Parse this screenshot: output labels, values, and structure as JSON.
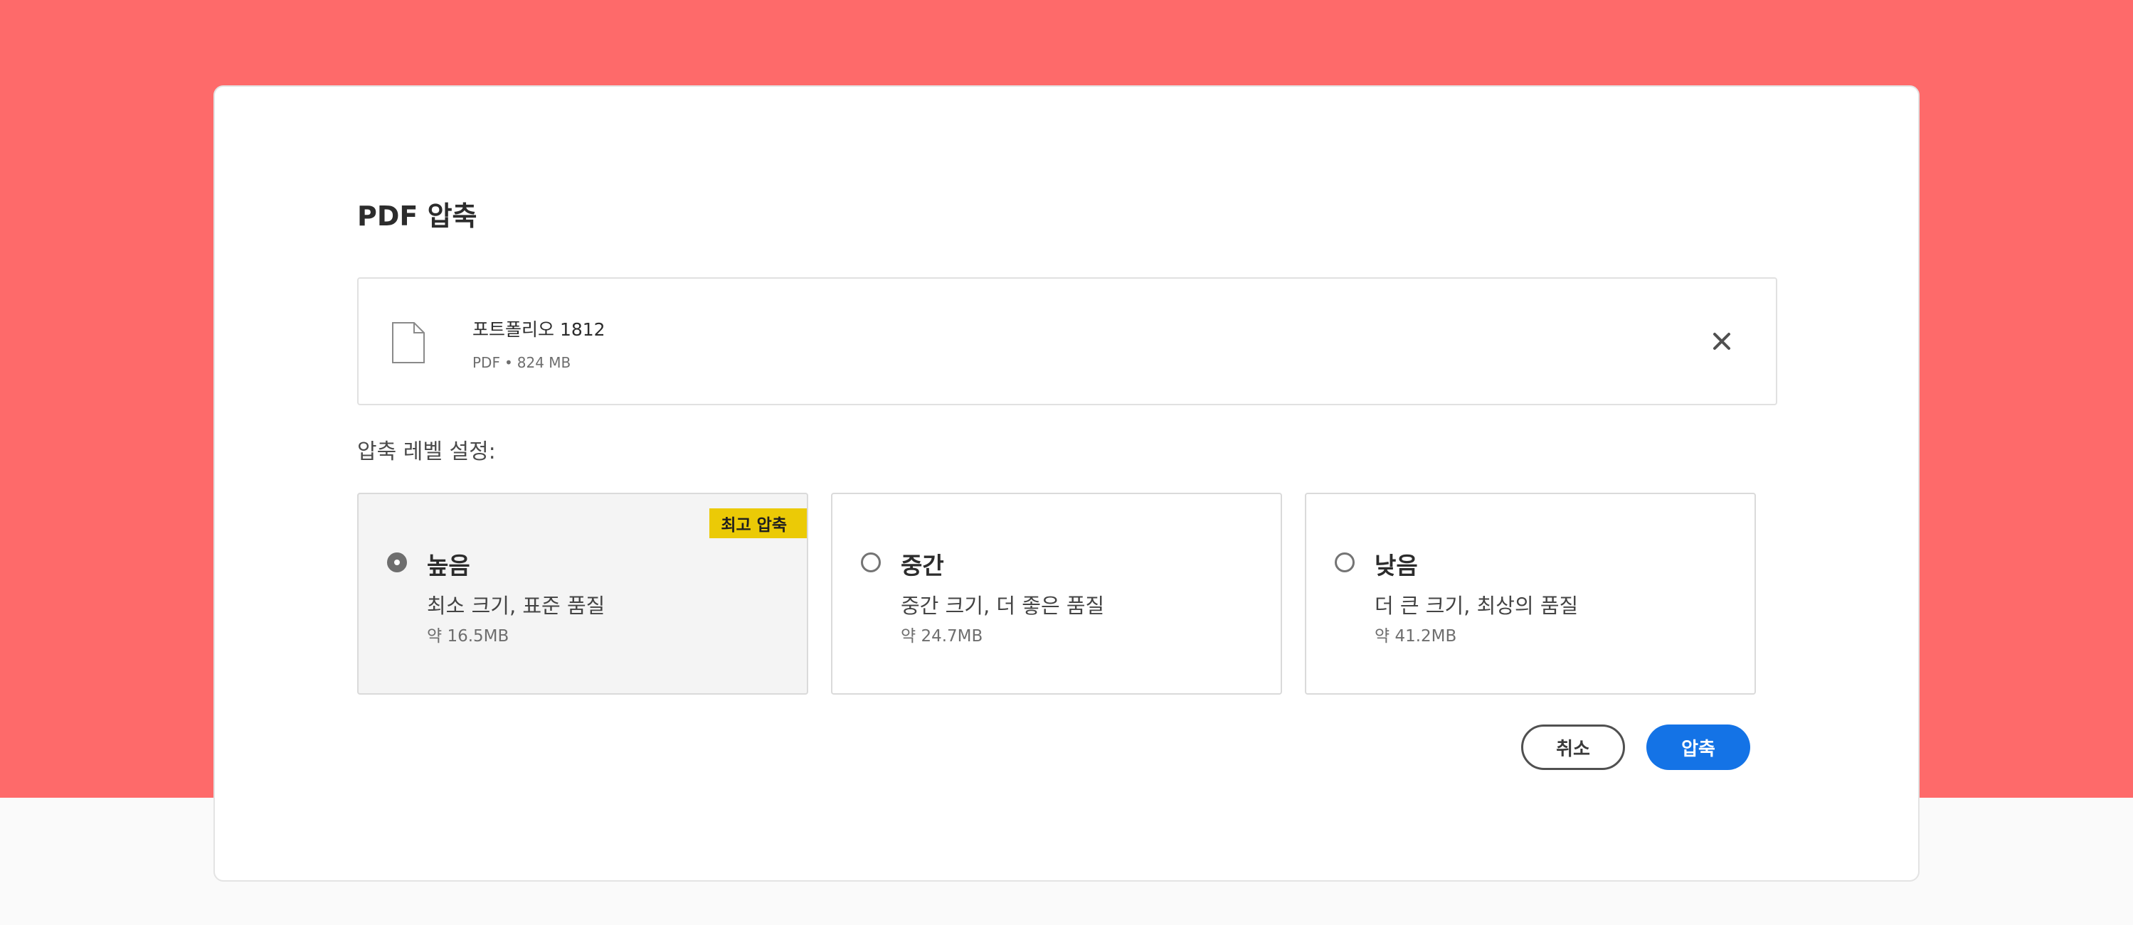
{
  "dialog": {
    "title": "PDF 압축"
  },
  "file": {
    "name": "포트폴리오 1812",
    "type": "PDF",
    "separator": "•",
    "size": "824 MB",
    "icon": "document-icon",
    "remove_icon": "close-icon"
  },
  "compression": {
    "label": "압축 레벨 설정:",
    "options": [
      {
        "title": "높음",
        "description": "최소 크기, 표준 품질",
        "size": "약 16.5MB",
        "badge": "최고 압축",
        "selected": true
      },
      {
        "title": "중간",
        "description": "중간 크기, 더 좋은 품질",
        "size": "약 24.7MB",
        "selected": false
      },
      {
        "title": "낮음",
        "description": "더 큰 크기, 최상의 품질",
        "size": "약 41.2MB",
        "selected": false
      }
    ]
  },
  "actions": {
    "cancel_label": "취소",
    "compress_label": "압축"
  },
  "colors": {
    "background_accent": "#fe6a6a",
    "primary_button": "#1473e6",
    "badge": "#ebca06"
  }
}
